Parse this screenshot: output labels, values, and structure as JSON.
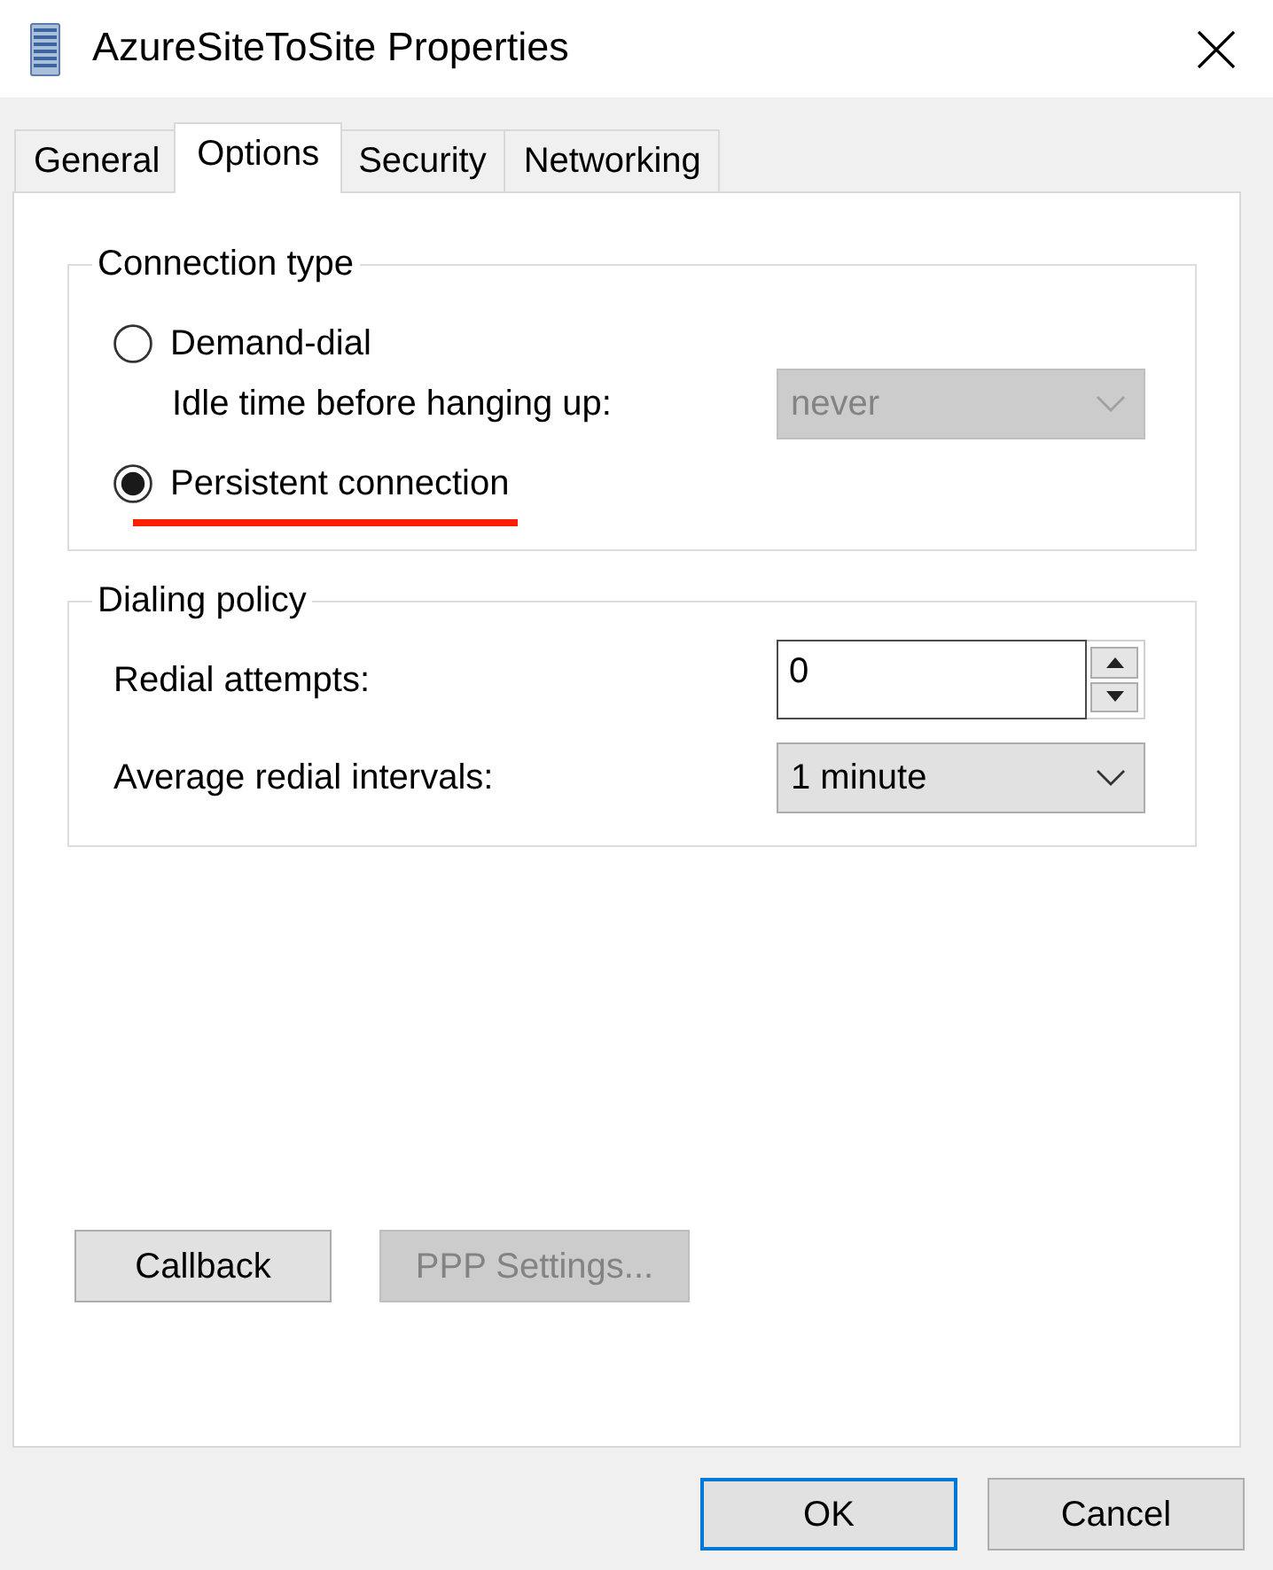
{
  "window": {
    "title": "AzureSiteToSite Properties"
  },
  "tabs": [
    {
      "label": "General",
      "selected": false
    },
    {
      "label": "Options",
      "selected": true
    },
    {
      "label": "Security",
      "selected": false
    },
    {
      "label": "Networking",
      "selected": false
    }
  ],
  "connection_type": {
    "title": "Connection type",
    "items": [
      {
        "kind": "radio",
        "label": "Demand-dial",
        "selected": false,
        "underlined": false
      },
      {
        "kind": "dropdown",
        "label": "Idle time before hanging up:",
        "value": "never",
        "disabled": true
      },
      {
        "kind": "radio",
        "label": "Persistent connection",
        "selected": true,
        "underlined": true
      }
    ]
  },
  "dialing_policy": {
    "title": "Dialing policy",
    "items": [
      {
        "kind": "spin",
        "label": "Redial attempts:",
        "value": "0"
      },
      {
        "kind": "dropdown",
        "label": "Average redial intervals:",
        "value": "1 minute",
        "disabled": false
      }
    ]
  },
  "buttons": [
    {
      "label": "Callback",
      "disabled": false
    },
    {
      "label": "PPP Settings...",
      "disabled": true
    }
  ],
  "footer_buttons": [
    {
      "label": "OK",
      "default": true
    },
    {
      "label": "Cancel",
      "default": false
    }
  ]
}
